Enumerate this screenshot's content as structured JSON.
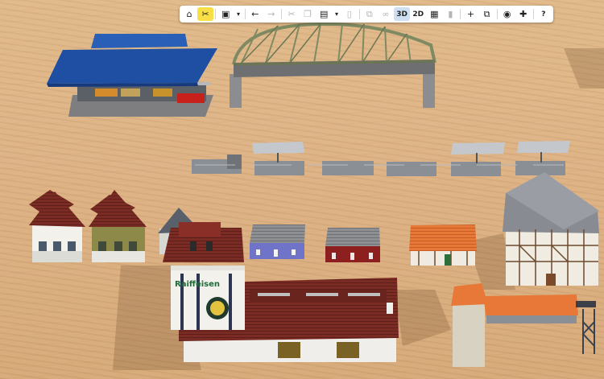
{
  "toolbar": {
    "view_3d_label": "3D",
    "view_2d_label": "2D",
    "help_label": "?",
    "buttons": [
      {
        "name": "home",
        "icon": "home-icon"
      },
      {
        "name": "edit-tools",
        "icon": "tools-icon",
        "active": true
      },
      {
        "name": "save",
        "icon": "floppy-icon"
      },
      {
        "name": "undo",
        "icon": "arrow-left-icon"
      },
      {
        "name": "redo",
        "icon": "arrow-right-icon",
        "disabled": true
      },
      {
        "name": "cut",
        "icon": "scissors-icon",
        "disabled": true
      },
      {
        "name": "copy",
        "icon": "copy-icon",
        "disabled": true
      },
      {
        "name": "paste",
        "icon": "clipboard-icon"
      },
      {
        "name": "delete",
        "icon": "trash-icon",
        "disabled": true
      },
      {
        "name": "duplicate",
        "icon": "duplicate-icon",
        "disabled": true
      },
      {
        "name": "link",
        "icon": "link-icon",
        "disabled": true
      },
      {
        "name": "grid",
        "icon": "grid-icon"
      },
      {
        "name": "train",
        "icon": "train-icon",
        "disabled": true
      },
      {
        "name": "add",
        "icon": "plus-icon"
      },
      {
        "name": "layers",
        "icon": "layers-icon"
      },
      {
        "name": "screenshot",
        "icon": "camera-icon"
      },
      {
        "name": "extensions",
        "icon": "puzzle-icon"
      }
    ]
  },
  "scene": {
    "models": [
      "bus-depot",
      "truss-bridge",
      "platform-segment",
      "platform-with-canopy",
      "station-house-white",
      "station-house-green",
      "small-house-grey",
      "shed-purple",
      "shed-red",
      "house-orange-roof",
      "half-timbered-hall",
      "raiffeisen-warehouse",
      "loading-tower-with-conveyor"
    ],
    "warehouse_sign": "Raiffeisen",
    "colors": {
      "table": "#dcb184",
      "depot_roof": "#1f4fa3",
      "bridge_truss": "#7f8a63",
      "roof_brown": "#7a2b24",
      "roof_orange": "#e77838",
      "shed_purple": "#6f74c8",
      "shed_red": "#8e1f1f",
      "concrete": "#8a8f95"
    }
  }
}
